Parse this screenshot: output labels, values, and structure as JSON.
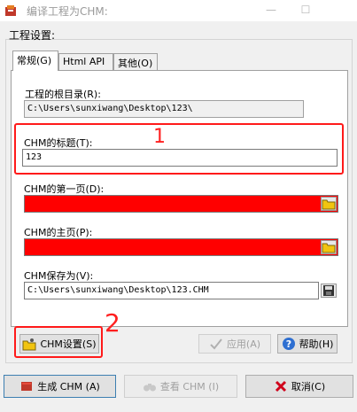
{
  "window": {
    "title": "编译工程为CHM:",
    "minimize": "—",
    "maximize": "☐"
  },
  "group": {
    "label": "工程设置:"
  },
  "tabs": [
    {
      "label": "常规(G)"
    },
    {
      "label": "Html API"
    },
    {
      "label": "其他(O)"
    }
  ],
  "fields": {
    "root_dir": {
      "label": "工程的根目录(R):",
      "value": "C:\\Users\\sunxiwang\\Desktop\\123\\"
    },
    "title": {
      "label": "CHM的标题(T):",
      "value": "123"
    },
    "first_page": {
      "label": "CHM的第一页(D):",
      "value": ""
    },
    "home_page": {
      "label": "CHM的主页(P):",
      "value": ""
    },
    "save_as": {
      "label": "CHM保存为(V):",
      "value": "C:\\Users\\sunxiwang\\Desktop\\123.CHM"
    }
  },
  "annotations": {
    "one": "1",
    "two": "2"
  },
  "buttons": {
    "chm_settings": "CHM设置(S)",
    "apply": "应用(A)",
    "help": "帮助(H)",
    "build": "生成 CHM (A)",
    "view": "查看 CHM (I)",
    "cancel": "取消(C)"
  },
  "colors": {
    "annotation": "#ff1a1a",
    "required_field": "#ff0000"
  }
}
